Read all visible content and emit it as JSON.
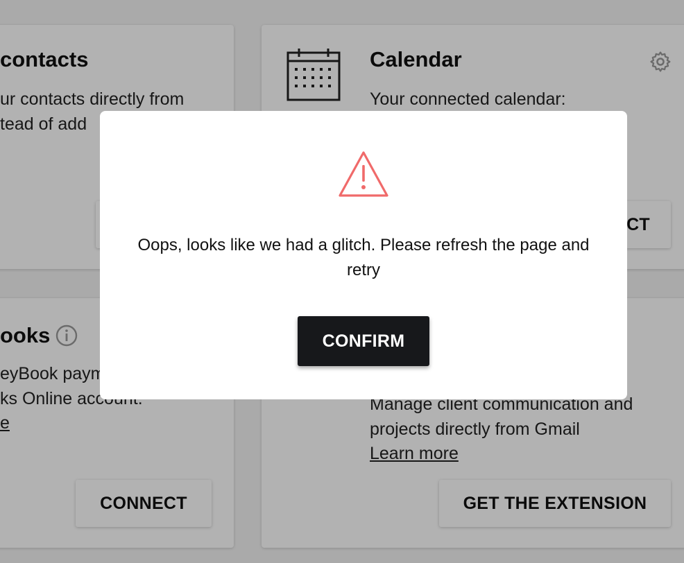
{
  "cards": {
    "contacts": {
      "title": "contacts",
      "line1": "ur contacts directly from",
      "line2": "tead of add"
    },
    "calendar": {
      "title": "Calendar",
      "line1": "Your connected calendar:",
      "button_fragment": "CT"
    },
    "books": {
      "title": "ooks",
      "line1": "eyBook paym",
      "line2": "ks Online account.",
      "link_fragment": "e",
      "connect_label": "CONNECT"
    },
    "gmail": {
      "line1": "Manage client communication and",
      "line2": "projects directly from Gmail",
      "learn_more": "Learn more",
      "extension_label": "GET THE EXTENSION"
    }
  },
  "modal": {
    "message": "Oops, looks like we had a glitch. Please refresh the page and retry",
    "confirm_label": "CONFIRM",
    "warning_color": "#f06a6a"
  },
  "icons": {
    "calendar": "calendar-icon",
    "settings": "gear-icon",
    "info": "info-icon",
    "warning": "warning-triangle-icon"
  }
}
